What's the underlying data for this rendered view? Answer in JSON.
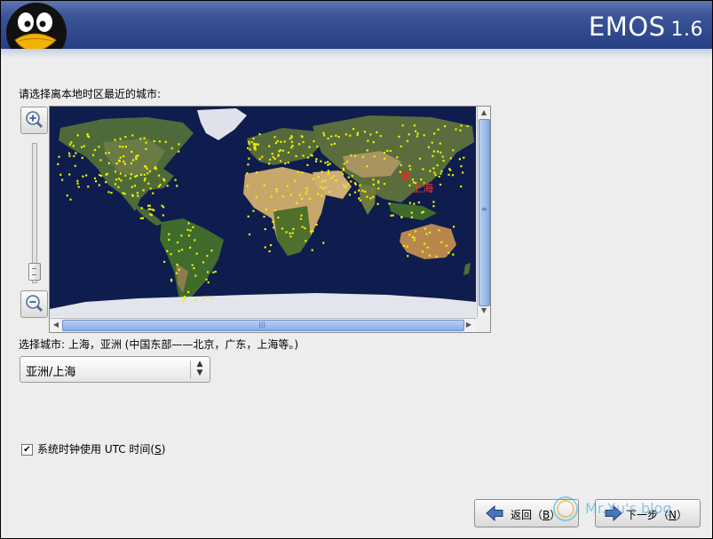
{
  "header": {
    "brand": "EMOS",
    "version": "1.6"
  },
  "instruction": "请选择离本地时区最近的城市:",
  "map": {
    "selected_city_label": "上海",
    "marker_color": "#ff2020",
    "city_dot_color": "#f0f000"
  },
  "selection_text": "选择城市: 上海，亚洲 (中国东部——北京，广东，上海等。)",
  "timezone_select": {
    "value": "亚洲/上海"
  },
  "utc_checkbox": {
    "checked": true,
    "label_prefix": "系统时钟使用 UTC 时间(",
    "mnemonic": "S",
    "label_suffix": ")"
  },
  "buttons": {
    "back": {
      "label_prefix": "返回（",
      "mnemonic": "B",
      "label_suffix": "）"
    },
    "next": {
      "label_prefix": "下一步（",
      "mnemonic": "N",
      "label_suffix": "）"
    }
  },
  "watermark": {
    "text": "Mr.Xu's blog"
  },
  "colors": {
    "header": "#2f4a8f",
    "background": "#ededed",
    "ocean": "#0f1c4e",
    "scroll_thumb": "#9dbdea"
  }
}
